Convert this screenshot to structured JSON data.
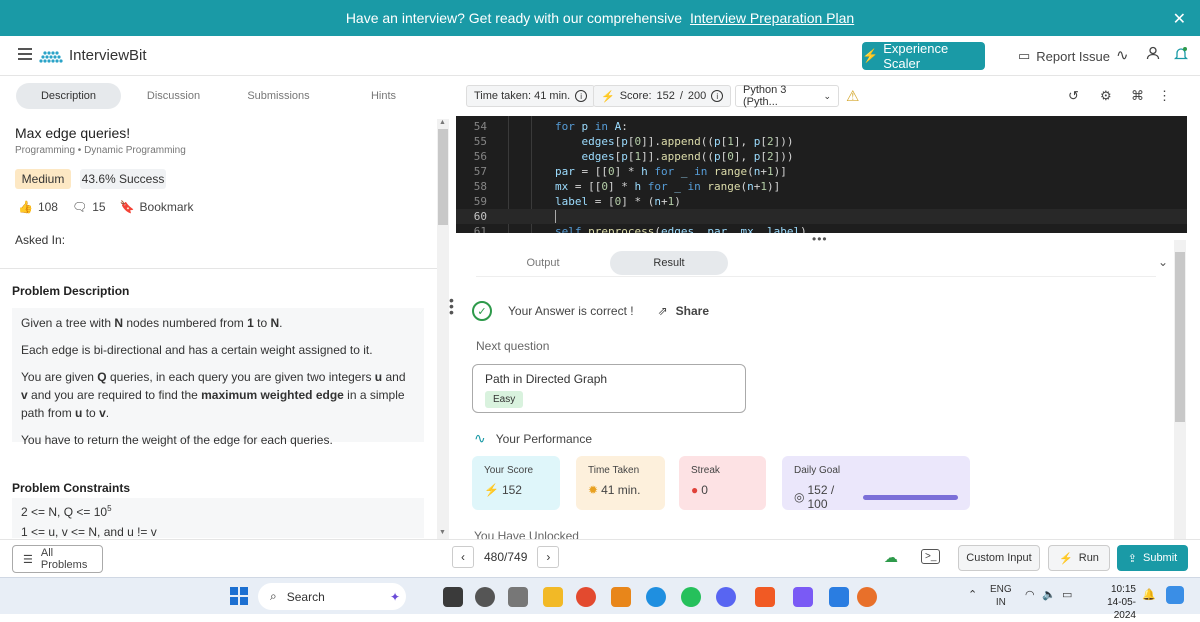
{
  "banner": {
    "text": "Have an interview? Get ready with our comprehensive",
    "link": "Interview Preparation Plan",
    "close": "✕"
  },
  "nav": {
    "logo": "InterviewBit",
    "experience_btn": "Experience Scaler",
    "report_issue": "Report Issue"
  },
  "left": {
    "tabs": [
      "Description",
      "Discussion",
      "Submissions",
      "Hints"
    ],
    "title": "Max edge queries!",
    "breadcrumbs": "Programming • Dynamic Programming",
    "difficulty": "Medium",
    "success": "43.6% Success",
    "likes": "108",
    "comments": "15",
    "bookmark": "Bookmark",
    "asked_in": "Asked In:",
    "problem_description_heading": "Problem Description",
    "desc": {
      "p1_a": "Given a tree with ",
      "p1_N": "N",
      "p1_b": " nodes numbered from ",
      "p1_1": "1",
      "p1_c": " to ",
      "p1_N2": "N",
      "p1_d": ".",
      "p2": "Each edge is bi-directional and has a certain weight assigned to it.",
      "p3_a": "You are given ",
      "p3_Q": "Q",
      "p3_b": " queries, in each query you are given two integers ",
      "p3_u": "u",
      "p3_c": " and ",
      "p3_v": "v",
      "p3_d": " and you are required to find the ",
      "p3_max": "maximum weighted edge",
      "p3_e": " in a simple path from ",
      "p3_u2": "u",
      "p3_f": " to ",
      "p3_v2": "v",
      "p3_g": ".",
      "p4": "You have to return the weight of the edge for each queries."
    },
    "constraints_heading": "Problem Constraints",
    "constraint1": "2 <= N, Q <= 10",
    "constraint1_exp": "5",
    "constraint2": "1 <= u, v <= N, and u != v"
  },
  "toolbar": {
    "time_taken": "Time taken: 41 min.",
    "score_label": "Score:",
    "score_value": "152",
    "score_sep": "/",
    "score_max": "200",
    "language": "Python 3 (Pyth..."
  },
  "editor": {
    "lines": [
      {
        "n": "54",
        "code": "for p in A:"
      },
      {
        "n": "55",
        "code": "    edges[p[0]].append((p[1], p[2]))"
      },
      {
        "n": "56",
        "code": "    edges[p[1]].append((p[0], p[2]))"
      },
      {
        "n": "57",
        "code": "par = [[0] * h for _ in range(n+1)]"
      },
      {
        "n": "58",
        "code": "mx = [[0] * h for _ in range(n+1)]"
      },
      {
        "n": "59",
        "code": "label = [0] * (n+1)"
      },
      {
        "n": "60",
        "code": ""
      },
      {
        "n": "61",
        "code": "self.preprocess(edges, par, mx, label)"
      }
    ]
  },
  "result": {
    "tabs": [
      "Output",
      "Result"
    ],
    "correct": "Your Answer is correct !",
    "share": "Share",
    "next_question": "Next question",
    "next_title": "Path in Directed Graph",
    "next_difficulty": "Easy",
    "performance": "Your Performance",
    "cards": [
      {
        "label": "Your Score",
        "value": "152",
        "bg": "#dff6fa"
      },
      {
        "label": "Time Taken",
        "value": "41 min.",
        "bg": "#fdf0dc"
      },
      {
        "label": "Streak",
        "value": "0",
        "bg": "#fde2e4"
      },
      {
        "label": "Daily Goal",
        "value": "152 / 100",
        "bg": "#ebe7fb"
      }
    ],
    "daily_goal_progress": 1.0,
    "unlocked": "You Have Unlocked"
  },
  "bottom": {
    "all_problems": "All Problems",
    "page": "480/749",
    "custom_input": "Custom Input",
    "run": "Run",
    "submit": "Submit"
  },
  "taskbar": {
    "search": "Search",
    "lang_top": "ENG",
    "lang_bottom": "IN",
    "time": "10:15",
    "date": "14-05-2024"
  },
  "colors": {
    "accent": "#1a9aa6",
    "banner": "#1a9aa6"
  }
}
